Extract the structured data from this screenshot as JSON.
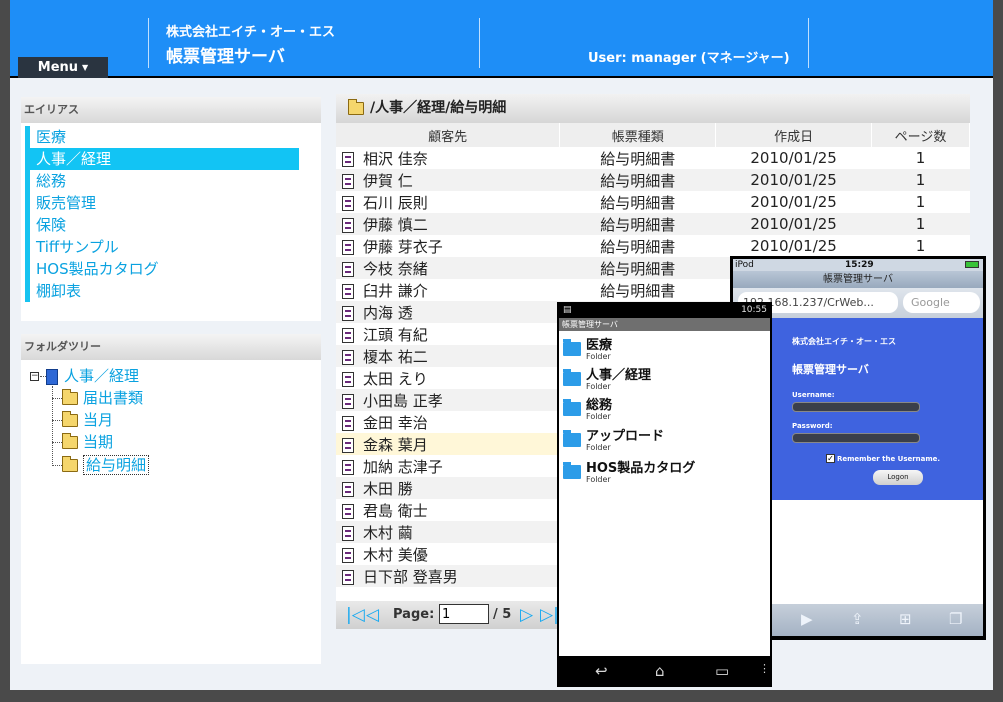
{
  "header": {
    "company": "株式会社エイチ・オー・エス",
    "app_title": "帳票管理サーバ",
    "user_info": "User: manager (マネージャー)",
    "menu_label": "Menu"
  },
  "alias_panel": {
    "title": "エイリアス",
    "items": [
      "医療",
      "人事／経理",
      "総務",
      "販売管理",
      "保険",
      "Tiffサンプル",
      "HOS製品カタログ",
      "棚卸表"
    ],
    "active_index": 1
  },
  "folder_tree": {
    "title": "フォルダツリー",
    "root": "人事／経理",
    "children": [
      "届出書類",
      "当月",
      "当期",
      "給与明細"
    ],
    "expander": "−"
  },
  "main": {
    "path": "/人事／経理/給与明細",
    "columns": [
      "顧客先",
      "帳票種類",
      "作成日",
      "ページ数"
    ],
    "rows": [
      [
        "相沢 佳奈",
        "給与明細書",
        "2010/01/25",
        "1"
      ],
      [
        "伊賀 仁",
        "給与明細書",
        "2010/01/25",
        "1"
      ],
      [
        "石川 辰則",
        "給与明細書",
        "2010/01/25",
        "1"
      ],
      [
        "伊藤 慎二",
        "給与明細書",
        "2010/01/25",
        "1"
      ],
      [
        "伊藤 芽衣子",
        "給与明細書",
        "2010/01/25",
        "1"
      ],
      [
        "今枝 奈緒",
        "給与明細書",
        "",
        ""
      ],
      [
        "臼井 謙介",
        "給与明細書",
        "",
        ""
      ],
      [
        "内海 透",
        "",
        "",
        ""
      ],
      [
        "江頭 有紀",
        "",
        "",
        ""
      ],
      [
        "榎本 祐二",
        "",
        "",
        ""
      ],
      [
        "太田 えり",
        "",
        "",
        ""
      ],
      [
        "小田島 正孝",
        "",
        "",
        ""
      ],
      [
        "金田 幸治",
        "",
        "",
        ""
      ],
      [
        "金森 葉月",
        "",
        "",
        ""
      ],
      [
        "加納 志津子",
        "",
        "",
        ""
      ],
      [
        "木田 勝",
        "",
        "",
        ""
      ],
      [
        "君島 衛士",
        "",
        "",
        ""
      ],
      [
        "木村 繭",
        "",
        "",
        ""
      ],
      [
        "木村 美優",
        "",
        "",
        ""
      ],
      [
        "日下部 登喜男",
        "",
        "",
        ""
      ]
    ],
    "highlight_row": 13
  },
  "pager": {
    "label": "Page:",
    "value": "1",
    "total": "/ 5"
  },
  "iphone": {
    "carrier": "iPod",
    "time": "15:29",
    "page_title": "帳票管理サーバ",
    "url": "192.168.1.237/CrWeb...",
    "search_placeholder": "Google",
    "company": "株式会社エイチ・オー・エス",
    "title": "帳票管理サーバ",
    "username_label": "Username:",
    "password_label": "Password:",
    "remember_label": "Remember the Username.",
    "logon_label": "Logon"
  },
  "android": {
    "time": "10:55",
    "page_title": "帳票管理サーバ",
    "sub_label": "Folder",
    "folders": [
      "医療",
      "人事／経理",
      "総務",
      "アップロード",
      "HOS製品カタログ"
    ]
  },
  "colors": {
    "header_blue": "#1e8ef7",
    "accent_cyan": "#12c4f4",
    "link_blue": "#0aa2e0",
    "highlight_row": "#fff7d8"
  }
}
